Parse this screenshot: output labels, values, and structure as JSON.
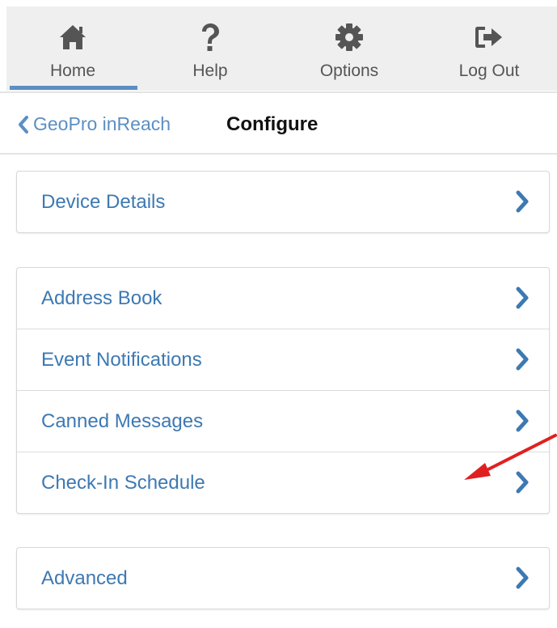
{
  "nav": {
    "items": [
      {
        "label": "Home",
        "icon": "home-icon"
      },
      {
        "label": "Help",
        "icon": "question-icon"
      },
      {
        "label": "Options",
        "icon": "gear-icon"
      },
      {
        "label": "Log Out",
        "icon": "logout-icon"
      }
    ],
    "active": "Home"
  },
  "breadcrumb": {
    "back_label": "GeoPro inReach",
    "current": "Configure"
  },
  "groups": [
    {
      "rows": [
        {
          "label": "Device Details"
        }
      ]
    },
    {
      "rows": [
        {
          "label": "Address Book"
        },
        {
          "label": "Event Notifications"
        },
        {
          "label": "Canned Messages"
        },
        {
          "label": "Check-In Schedule"
        }
      ]
    },
    {
      "rows": [
        {
          "label": "Advanced"
        }
      ]
    }
  ],
  "colors": {
    "link": "#3d79b2",
    "accent": "#5b8fc3",
    "icon": "#555555",
    "annotation_arrow": "#e02020"
  }
}
